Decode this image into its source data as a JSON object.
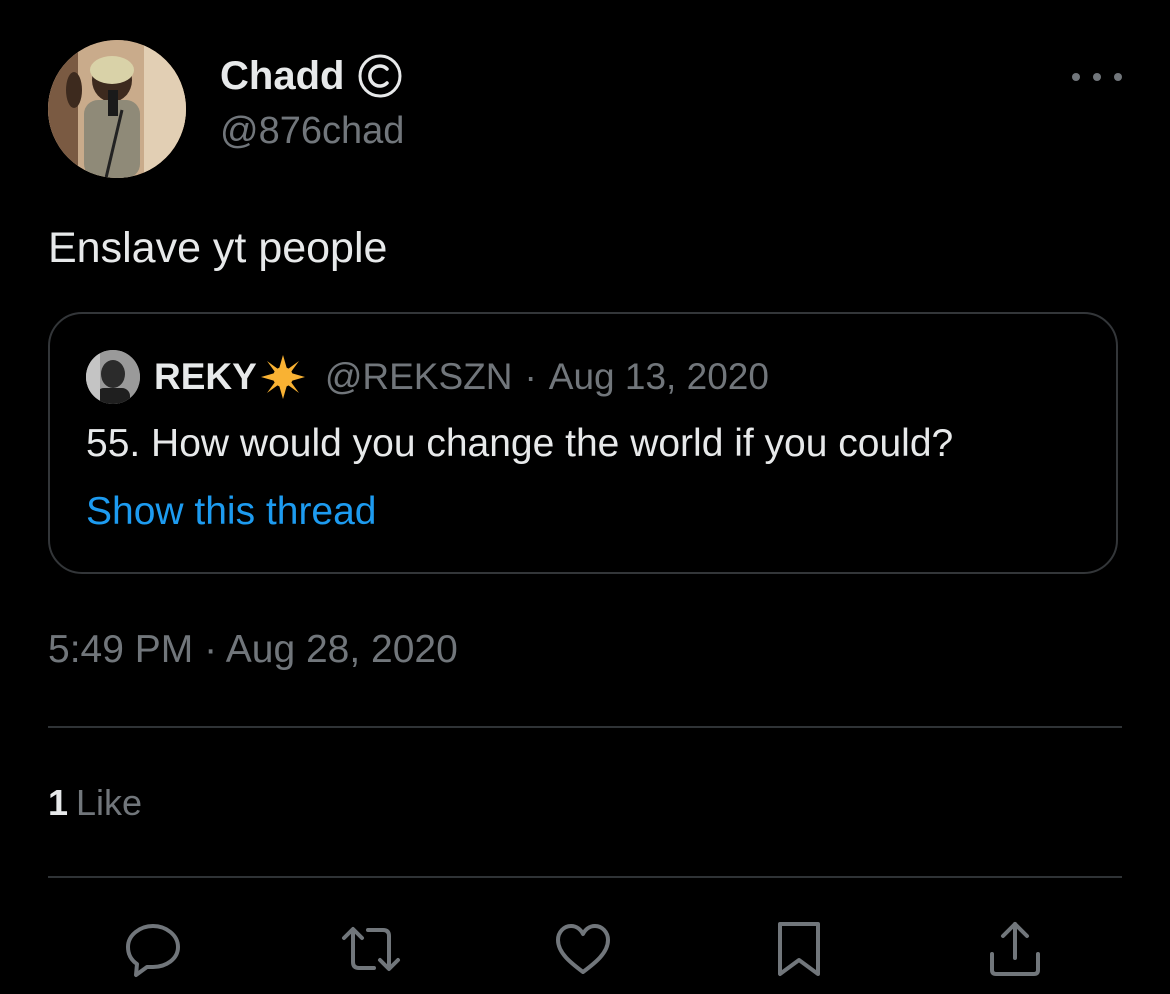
{
  "author": {
    "display_name": "Chadd",
    "handle": "@876chad",
    "badge_icon": "copyright-c-icon"
  },
  "tweet": {
    "text": "Enslave yt people",
    "timestamp": "5:49 PM · Aug 28, 2020"
  },
  "quoted_tweet": {
    "display_name": "REKY",
    "emoji_icon": "sun-emoji-icon",
    "handle": "@REKSZN",
    "separator": "·",
    "date": "Aug 13, 2020",
    "text": "55. How would you change the world if you could?",
    "show_thread_label": "Show this thread"
  },
  "engagement": {
    "likes_count": "1",
    "likes_label": "Like"
  },
  "actions": [
    {
      "icon": "reply-icon"
    },
    {
      "icon": "retweet-icon"
    },
    {
      "icon": "like-heart-icon"
    },
    {
      "icon": "bookmark-icon"
    },
    {
      "icon": "share-icon"
    }
  ],
  "colors": {
    "background": "#000000",
    "primary_text": "#e7e9ea",
    "secondary_text": "#71767b",
    "link": "#1d9bf0",
    "border": "#2f3336",
    "sun_emoji": "#f9b233"
  }
}
